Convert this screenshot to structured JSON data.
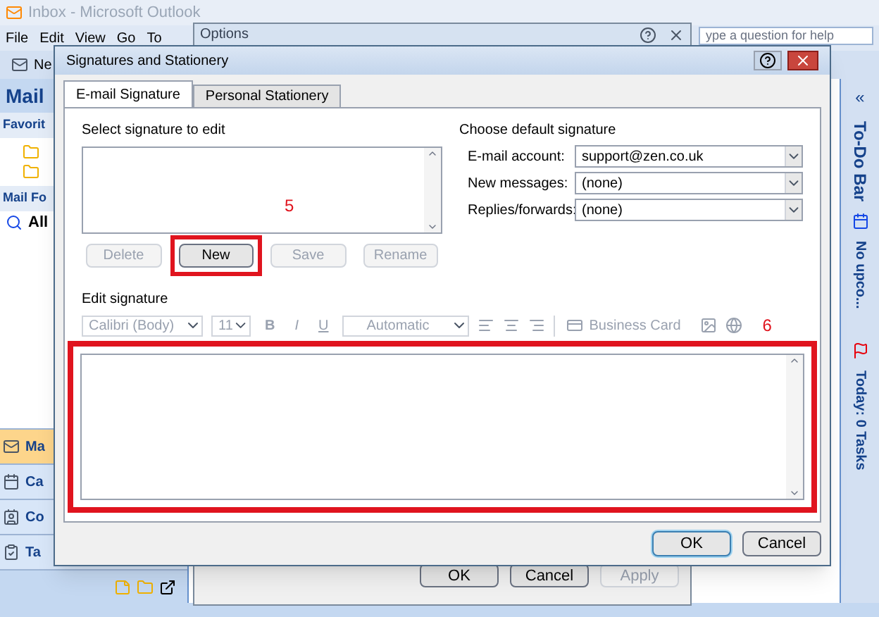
{
  "main_window": {
    "title": "Inbox - Microsoft Outlook",
    "menu": [
      "File",
      "Edit",
      "View",
      "Go",
      "To"
    ],
    "help_field": {
      "placeholder": "ype a question for help"
    },
    "toolbar": [
      "Ne"
    ],
    "nav_pane": {
      "title": "Mail",
      "sections": [
        "Favorit",
        "Mail Fo"
      ],
      "folder": "All"
    },
    "nav_buttons": [
      {
        "label": "Ma",
        "kind": "mail",
        "selected": true
      },
      {
        "label": "Ca",
        "kind": "calendar",
        "selected": false
      },
      {
        "label": "Co",
        "kind": "contacts",
        "selected": false
      },
      {
        "label": "Ta",
        "kind": "tasks",
        "selected": false
      }
    ],
    "todo_bar": {
      "collapse": "«",
      "title": "To-Do Bar",
      "appointments": "No upco...",
      "tasks": "Today: 0 Tasks"
    }
  },
  "options_dialog": {
    "title": "Options",
    "buttons": [
      {
        "label": "OK",
        "disabled": false
      },
      {
        "label": "Cancel",
        "disabled": false
      },
      {
        "label": "Apply",
        "disabled": true
      }
    ]
  },
  "signatures_dialog": {
    "title": "Signatures and Stationery",
    "tabs": [
      {
        "label": "E-mail Signature",
        "selected": true
      },
      {
        "label": "Personal Stationery",
        "selected": false
      }
    ],
    "select_label": "Select signature to edit",
    "signature_buttons": [
      {
        "label": "Delete",
        "disabled": true,
        "highlighted": false
      },
      {
        "label": "New",
        "disabled": false,
        "highlighted": true
      },
      {
        "label": "Save",
        "disabled": true,
        "highlighted": false
      },
      {
        "label": "Rename",
        "disabled": true,
        "highlighted": false
      }
    ],
    "default_label": "Choose default signature",
    "defaults": [
      {
        "label": "E-mail account:",
        "value": "support@zen.co.uk"
      },
      {
        "label": "New messages:",
        "value": "(none)"
      },
      {
        "label": "Replies/forwards:",
        "value": "(none)"
      }
    ],
    "edit_label": "Edit signature",
    "format_bar": {
      "font": "Calibri (Body)",
      "size": "11",
      "bold": "B",
      "italic": "I",
      "underline": "U",
      "font_color": "Automatic",
      "business_card": "Business Card"
    },
    "buttons": [
      {
        "label": "OK",
        "default": true
      },
      {
        "label": "Cancel",
        "default": false
      }
    ]
  },
  "annotations": [
    "5",
    "6"
  ]
}
